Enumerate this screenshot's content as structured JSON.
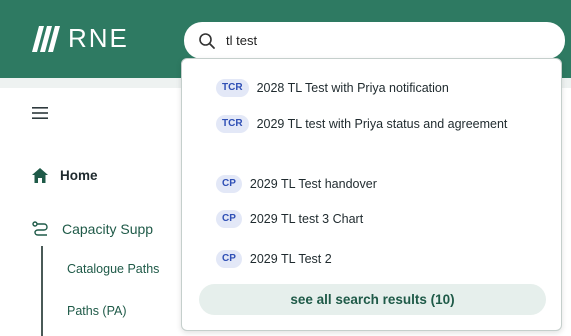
{
  "header": {
    "logo_text": "RNE",
    "search": {
      "value": "tl test"
    }
  },
  "nav": {
    "home_label": "Home",
    "capacity_label": "Capacity Supp",
    "sub_items": [
      "Catalogue Paths",
      "Paths (PA)"
    ]
  },
  "dropdown": {
    "results": [
      {
        "badge": "TCR",
        "title": "2028 TL Test with Priya notification"
      },
      {
        "badge": "TCR",
        "title": "2029 TL test with Priya status and agreement"
      },
      {
        "badge": "CP",
        "title": "2029 TL Test handover"
      },
      {
        "badge": "CP",
        "title": "2029 TL test 3 Chart"
      },
      {
        "badge": "CP",
        "title": "2029 TL Test 2"
      }
    ],
    "see_all_label": "see all search results (10)"
  },
  "colors": {
    "header_bg": "#2e7a62",
    "badge_bg": "#e3e8f7",
    "badge_text": "#2f4fb5",
    "see_all_bg": "#e6efec",
    "nav_accent": "#1f5a48"
  },
  "icons": {
    "search": "search-icon",
    "menu": "hamburger-menu-icon",
    "home": "home-icon",
    "capacity": "route-icon",
    "logo": "rne-logo-icon"
  }
}
